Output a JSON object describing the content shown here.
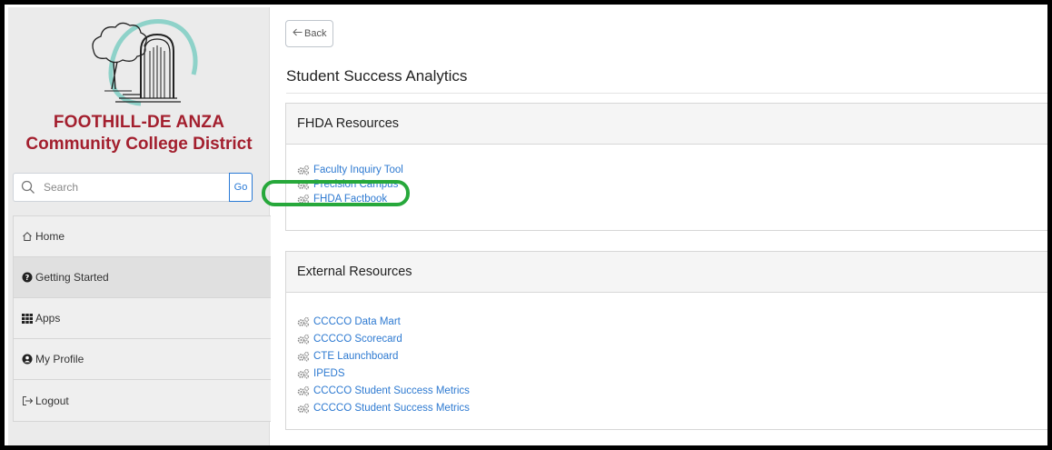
{
  "sidebar": {
    "district_line1": "FOOTHILL-DE ANZA",
    "district_line2": "Community College District",
    "search": {
      "placeholder": "Search",
      "button_label": "Go"
    },
    "nav_items": [
      {
        "label": "Home",
        "icon": "home-icon"
      },
      {
        "label": "Getting Started",
        "icon": "question-circle-icon"
      },
      {
        "label": "Apps",
        "icon": "grid-icon"
      },
      {
        "label": "My Profile",
        "icon": "user-circle-icon"
      },
      {
        "label": "Logout",
        "icon": "logout-icon"
      }
    ]
  },
  "main": {
    "back_label": "Back",
    "page_title": "Student Success Analytics",
    "panels": [
      {
        "title": "FHDA Resources",
        "links": [
          "Faculty Inquiry Tool",
          "Precision Campus",
          "FHDA Factbook"
        ]
      },
      {
        "title": "External Resources",
        "links": [
          "CCCCO Data Mart",
          "CCCCO Scorecard",
          "CTE Launchboard",
          "IPEDS",
          "CCCCO Student Success Metrics",
          "CCCCO Student Success Metrics"
        ]
      }
    ]
  },
  "colors": {
    "brand_red": "#a31f2e",
    "link_blue": "#2e7ad1",
    "highlight_green": "#27a83b",
    "logo_teal": "#8ed2c9"
  }
}
